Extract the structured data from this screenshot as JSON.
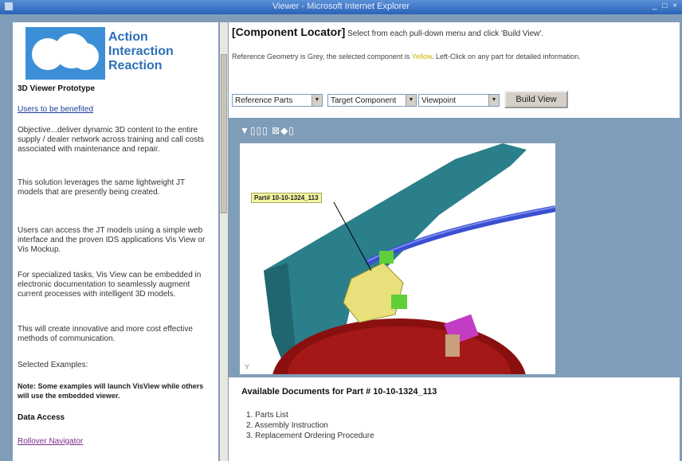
{
  "window": {
    "title": "Viewer - Microsoft Internet Explorer",
    "controls": "_ □ ×"
  },
  "logo": {
    "line1": "Action",
    "line2": "Interaction",
    "line3": "Reaction"
  },
  "sidebar": {
    "heading": "3D Viewer Prototype",
    "link_top": "Users to be benefited",
    "p1": "Objective...deliver dynamic 3D content to the entire supply / dealer network across training and call costs associated with maintenance and repair.",
    "p2": "This solution leverages the same lightweight JT models that are presently being created.",
    "p3": "Users can access the JT models using a simple web interface and the proven IDS applications Vis View or Vis Mockup.",
    "p4": "For specialized tasks, Vis View can be embedded in electronic documentation to seamlessly augment current processes with intelligent 3D models.",
    "p5": "This will create innovative and more cost effective methods of communication.",
    "examples_label": "Selected Examples:",
    "note": "Note: Some examples will launch VisView while others will use the embedded viewer.",
    "data_access": "Data Access",
    "link_bottom": "Rollover Navigator"
  },
  "locator": {
    "title": "[Component Locator]",
    "instruction": "Select from each pull-down menu and click 'Build View'.",
    "desc_a": "Reference Geometry is Grey, the selected component is ",
    "desc_yellow": "Yellow",
    "desc_b": ". Left-Click on any part for detailed information.",
    "select1": "Reference Parts",
    "select2": "Target Component",
    "select3": "Viewpoint",
    "build_button": "Build View"
  },
  "viewer": {
    "toolbar": "▼▯▯▯ ⊠◆▯",
    "part_label": "Part# 10-10-1324_113",
    "axis_marker": "Y"
  },
  "docs": {
    "title": "Available Documents for Part # 10-10-1324_113",
    "items": [
      "1. Parts List",
      "2. Assembly Instruction",
      "3. Replacement Ordering Procedure"
    ]
  }
}
